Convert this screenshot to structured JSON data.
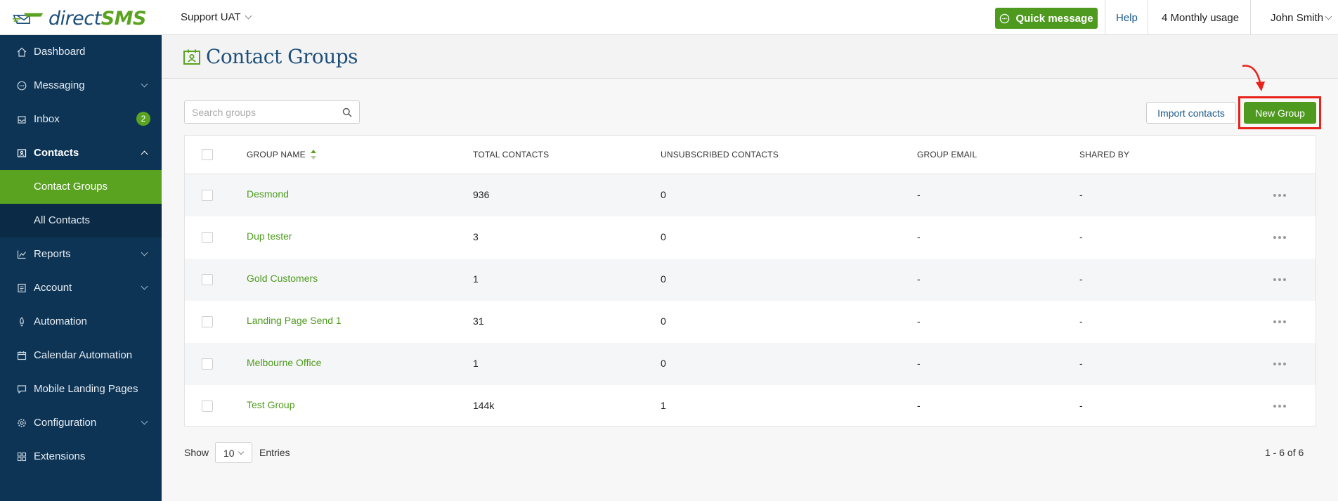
{
  "header": {
    "logo": {
      "brand_part1": "direct",
      "brand_part2": "SMS"
    },
    "account_selector": "Support UAT",
    "quick_message_label": "Quick message",
    "help_label": "Help",
    "usage_label": "4 Monthly usage",
    "user_name": "John Smith"
  },
  "sidebar": {
    "items": [
      {
        "label": "Dashboard",
        "icon": "home-icon"
      },
      {
        "label": "Messaging",
        "icon": "chat-icon"
      },
      {
        "label": "Inbox",
        "icon": "inbox-icon",
        "badge": "2"
      },
      {
        "label": "Contacts",
        "icon": "contacts-icon"
      },
      {
        "label": "Contact Groups"
      },
      {
        "label": "All Contacts"
      },
      {
        "label": "Reports",
        "icon": "chart-icon"
      },
      {
        "label": "Account",
        "icon": "account-icon"
      },
      {
        "label": "Automation",
        "icon": "rocket-icon"
      },
      {
        "label": "Calendar Automation",
        "icon": "calendar-icon"
      },
      {
        "label": "Mobile Landing Pages",
        "icon": "message-icon"
      },
      {
        "label": "Configuration",
        "icon": "gear-icon"
      },
      {
        "label": "Extensions",
        "icon": "grid-icon"
      }
    ]
  },
  "page": {
    "title": "Contact Groups",
    "search_placeholder": "Search groups",
    "import_label": "Import contacts",
    "new_group_label": "New Group"
  },
  "table": {
    "columns": [
      "GROUP NAME",
      "TOTAL CONTACTS",
      "UNSUBSCRIBED CONTACTS",
      "GROUP EMAIL",
      "SHARED BY"
    ],
    "rows": [
      {
        "name": "Desmond",
        "total": "936",
        "unsub": "0",
        "email": "-",
        "shared": "-"
      },
      {
        "name": "Dup tester",
        "total": "3",
        "unsub": "0",
        "email": "-",
        "shared": "-"
      },
      {
        "name": "Gold Customers",
        "total": "1",
        "unsub": "0",
        "email": "-",
        "shared": "-"
      },
      {
        "name": "Landing Page Send 1",
        "total": "31",
        "unsub": "0",
        "email": "-",
        "shared": "-"
      },
      {
        "name": "Melbourne Office",
        "total": "1",
        "unsub": "0",
        "email": "-",
        "shared": "-"
      },
      {
        "name": "Test Group",
        "total": "144k",
        "unsub": "1",
        "email": "-",
        "shared": "-"
      }
    ]
  },
  "footer": {
    "show_label": "Show",
    "page_size": "10",
    "entries_label": "Entries",
    "pagination": "1 - 6 of 6"
  },
  "colors": {
    "accent_green": "#4e9a1f",
    "sidebar_bg": "#0e3455",
    "brand_blue": "#1d4f7a",
    "annotation_red": "#e8221b"
  }
}
